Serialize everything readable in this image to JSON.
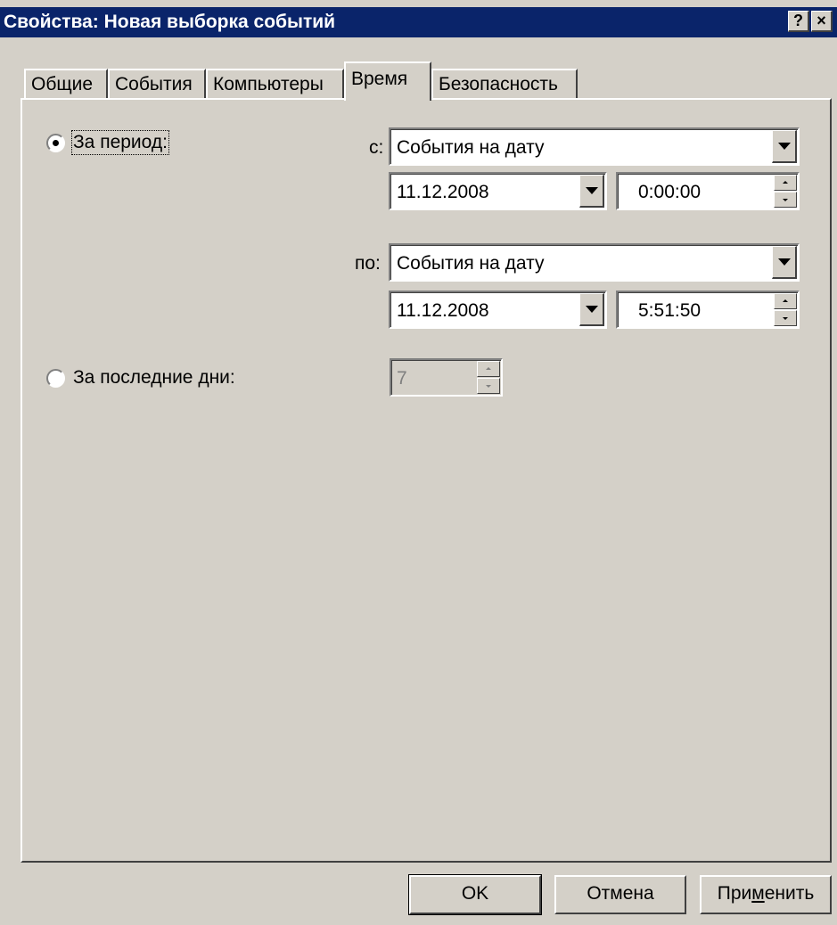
{
  "window": {
    "title": "Свойства: Новая выборка событий",
    "help_button": "?",
    "close_button": "×"
  },
  "tabs": [
    {
      "label": "Общие",
      "active": false
    },
    {
      "label": "События",
      "active": false
    },
    {
      "label": "Компьютеры",
      "active": false
    },
    {
      "label": "Время",
      "active": true
    },
    {
      "label": "Безопасность",
      "active": false
    }
  ],
  "period": {
    "radio_label": "За период:",
    "selected": true,
    "from": {
      "label": "с:",
      "mode": "События на дату",
      "date": "11.12.2008",
      "time": "0:00:00"
    },
    "to": {
      "label": "по:",
      "mode": "События на дату",
      "date": "11.12.2008",
      "time": "5:51:50"
    }
  },
  "last_days": {
    "radio_label": "За последние дни:",
    "selected": false,
    "value": "7",
    "enabled": false
  },
  "buttons": {
    "ok": "OK",
    "cancel": "Отмена",
    "apply_pre": "При",
    "apply_u": "м",
    "apply_post": "енить"
  }
}
